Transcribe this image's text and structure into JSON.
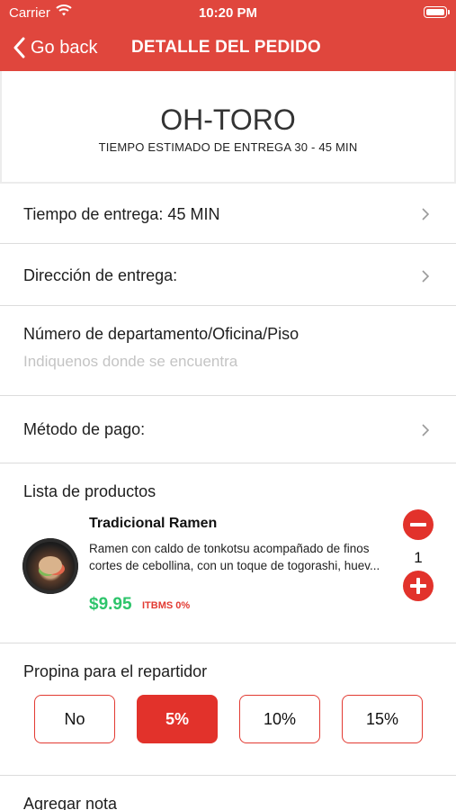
{
  "status_bar": {
    "carrier": "Carrier",
    "time": "10:20 PM"
  },
  "nav": {
    "back_label": "Go back",
    "title": "DETALLE DEL PEDIDO"
  },
  "restaurant": {
    "name": "OH-TORO",
    "eta": "TIEMPO ESTIMADO DE ENTREGA 30 - 45 MIN"
  },
  "rows": {
    "delivery_time": "Tiempo de entrega: 45 MIN",
    "delivery_address": "Dirección de entrega:",
    "apartment": {
      "label": "Número de departamento/Oficina/Piso",
      "placeholder": "Indiquenos donde se encuentra"
    },
    "payment_method": "Método de pago:"
  },
  "products": {
    "title": "Lista de productos",
    "items": [
      {
        "name": "Tradicional Ramen",
        "description": "Ramen con caldo de tonkotsu acompañado de finos cortes de cebollina, con un toque de togorashi, huev...",
        "price": "$9.95",
        "tax": "ITBMS 0%",
        "quantity": "1"
      }
    ]
  },
  "tip": {
    "title": "Propina para el repartidor",
    "options": [
      "No",
      "5%",
      "10%",
      "15%"
    ],
    "selected": "5%"
  },
  "note": {
    "label": "Agregar nota"
  },
  "colors": {
    "brand": "#e0463d",
    "accent_red": "#e2322b",
    "price_green": "#2ec46b"
  }
}
